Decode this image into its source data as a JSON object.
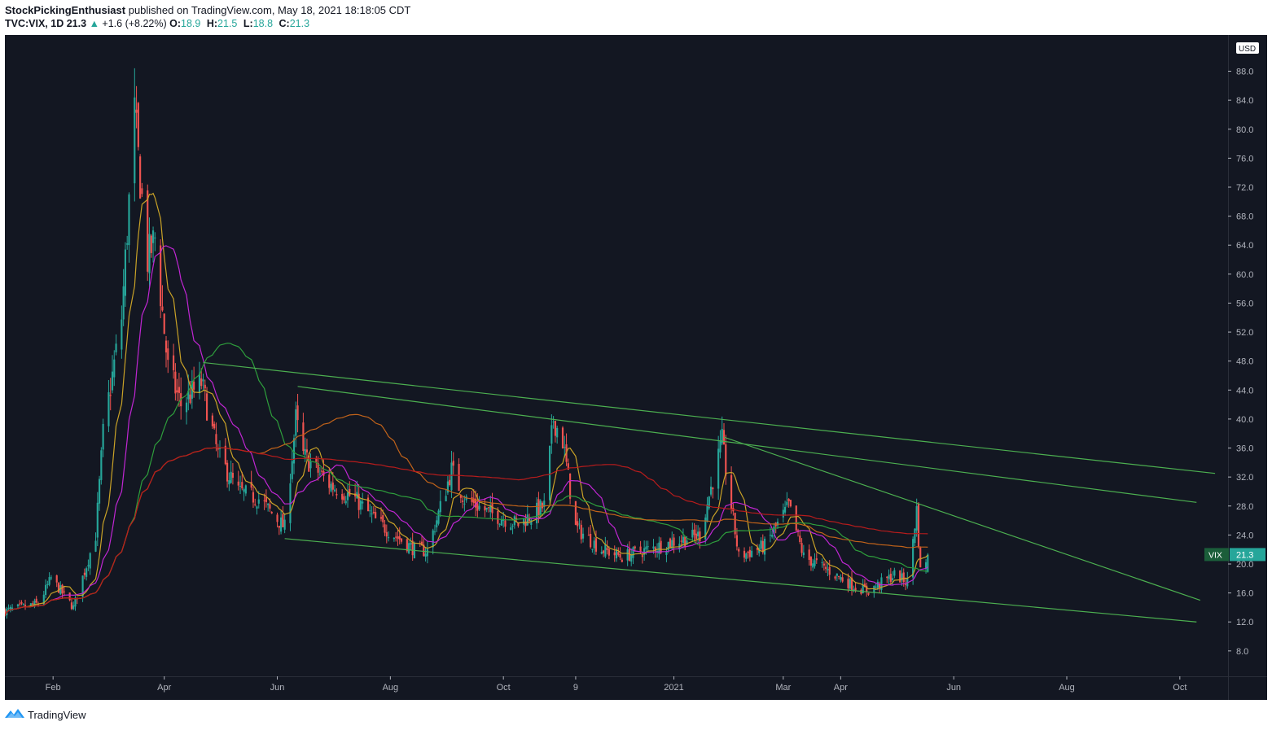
{
  "header": {
    "author": "StockPickingEnthusiast",
    "published_text": "published on TradingView.com, May 18, 2021 18:18:05 CDT",
    "symbol": "TVC:VIX, 1D",
    "last": "21.3",
    "change_arrow": "▲",
    "change": "+1.6 (+8.22%)",
    "o_label": "O:",
    "o_value": "18.9",
    "h_label": "H:",
    "h_value": "21.5",
    "l_label": "L:",
    "l_value": "18.8",
    "c_label": "C:",
    "c_value": "21.3"
  },
  "footer": {
    "brand": "TradingView"
  },
  "colors": {
    "background": "#131722",
    "up": "#26a69a",
    "down": "#ef5350",
    "trendline": "#4caf50",
    "axis_text": "#b2b5be"
  },
  "chart_data": {
    "type": "candlestick",
    "currency": "USD",
    "symbol_badge": "VIX",
    "last_price": "21.3",
    "y_ticks": [
      "8.0",
      "12.0",
      "16.0",
      "20.0",
      "24.0",
      "28.0",
      "32.0",
      "36.0",
      "40.0",
      "44.0",
      "48.0",
      "52.0",
      "56.0",
      "60.0",
      "64.0",
      "68.0",
      "72.0",
      "76.0",
      "80.0",
      "84.0",
      "88.0"
    ],
    "x_ticks": [
      "Feb",
      "Apr",
      "Jun",
      "Aug",
      "Oct",
      "9",
      "2021",
      "Mar",
      "Apr",
      "Jun",
      "Aug",
      "Oct"
    ],
    "x_tick_dates": [
      "2020-02-01",
      "2020-04-01",
      "2020-06-01",
      "2020-08-01",
      "2020-10-01",
      "2020-11-09",
      "2021-01-01",
      "2021-03-01",
      "2021-04-01",
      "2021-06-01",
      "2021-08-01",
      "2021-10-01"
    ],
    "ylim": [
      4.5,
      93
    ],
    "xlim": [
      "2020-01-06",
      "2021-10-27"
    ],
    "keypoints": [
      [
        "2020-01-06",
        13.5
      ],
      [
        "2020-01-24",
        14.5
      ],
      [
        "2020-01-31",
        18.0
      ],
      [
        "2020-02-12",
        14.0
      ],
      [
        "2020-02-24",
        24.0
      ],
      [
        "2020-02-28",
        38.0
      ],
      [
        "2020-03-09",
        54.0
      ],
      [
        "2020-03-16",
        82.0
      ],
      [
        "2020-03-18",
        76.0
      ],
      [
        "2020-03-23",
        62.0
      ],
      [
        "2020-03-27",
        65.0
      ],
      [
        "2020-04-03",
        47.0
      ],
      [
        "2020-04-10",
        42.0
      ],
      [
        "2020-04-21",
        45.0
      ],
      [
        "2020-04-30",
        35.0
      ],
      [
        "2020-05-11",
        30.0
      ],
      [
        "2020-05-22",
        29.0
      ],
      [
        "2020-06-05",
        25.0
      ],
      [
        "2020-06-11",
        40.0
      ],
      [
        "2020-06-15",
        35.0
      ],
      [
        "2020-06-29",
        31.0
      ],
      [
        "2020-07-13",
        29.0
      ],
      [
        "2020-07-24",
        26.0
      ],
      [
        "2020-08-03",
        24.0
      ],
      [
        "2020-08-14",
        22.0
      ],
      [
        "2020-08-21",
        21.8
      ],
      [
        "2020-09-03",
        33.0
      ],
      [
        "2020-09-10",
        29.0
      ],
      [
        "2020-09-24",
        27.0
      ],
      [
        "2020-10-09",
        25.5
      ],
      [
        "2020-10-23",
        28.0
      ],
      [
        "2020-10-28",
        40.0
      ],
      [
        "2020-11-02",
        37.0
      ],
      [
        "2020-11-09",
        25.0
      ],
      [
        "2020-11-23",
        22.0
      ],
      [
        "2020-12-04",
        21.0
      ],
      [
        "2020-12-18",
        22.0
      ],
      [
        "2020-12-31",
        23.0
      ],
      [
        "2021-01-15",
        24.0
      ],
      [
        "2021-01-27",
        37.0
      ],
      [
        "2021-01-29",
        33.0
      ],
      [
        "2021-02-05",
        21.0
      ],
      [
        "2021-02-19",
        22.5
      ],
      [
        "2021-03-04",
        28.0
      ],
      [
        "2021-03-12",
        21.0
      ],
      [
        "2021-03-26",
        19.0
      ],
      [
        "2021-04-09",
        16.8
      ],
      [
        "2021-04-16",
        16.3
      ],
      [
        "2021-04-30",
        18.5
      ],
      [
        "2021-05-07",
        17.5
      ],
      [
        "2021-05-12",
        27.5
      ],
      [
        "2021-05-14",
        19.0
      ],
      [
        "2021-05-18",
        21.3
      ]
    ],
    "trendlines": [
      {
        "name": "upper-1",
        "from": [
          "2020-04-22",
          47.8
        ],
        "to": [
          "2021-10-20",
          32.5
        ]
      },
      {
        "name": "upper-2",
        "from": [
          "2020-06-12",
          44.5
        ],
        "to": [
          "2021-10-10",
          28.5
        ]
      },
      {
        "name": "upper-3",
        "from": [
          "2021-01-28",
          37.5
        ],
        "to": [
          "2021-10-12",
          15.0
        ]
      },
      {
        "name": "lower",
        "from": [
          "2020-06-05",
          23.5
        ],
        "to": [
          "2021-10-10",
          12.0
        ]
      }
    ]
  }
}
